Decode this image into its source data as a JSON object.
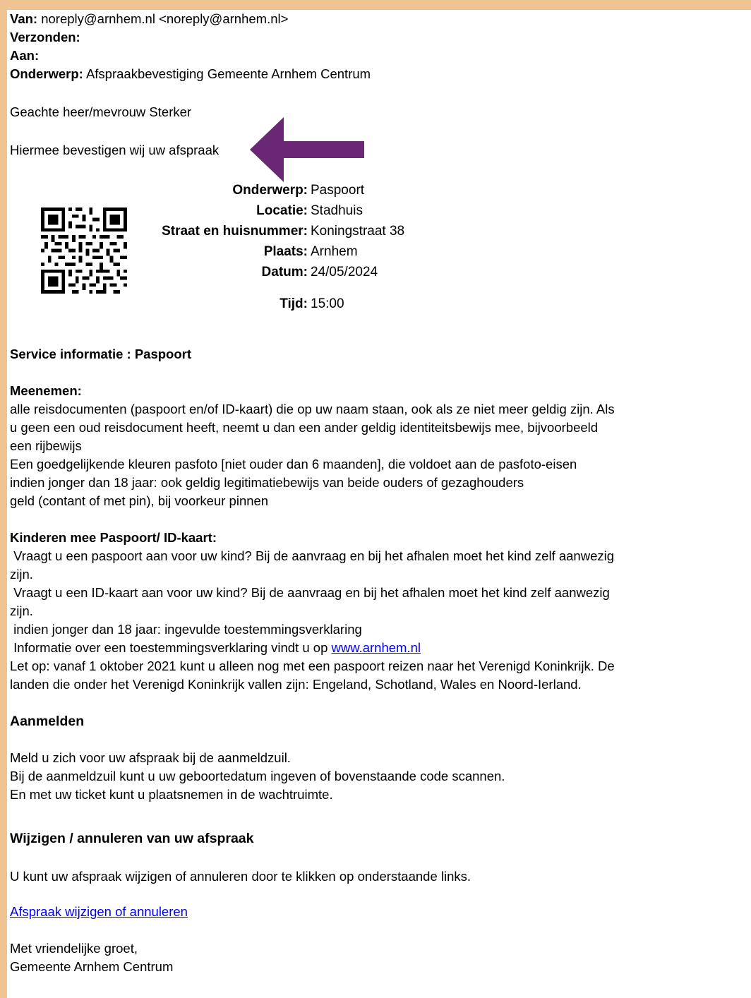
{
  "header": {
    "from_label": "Van:",
    "from_value": "noreply@arnhem.nl <noreply@arnhem.nl>",
    "sent_label": "Verzonden:",
    "to_label": "Aan:",
    "subject_label": "Onderwerp:",
    "subject_value": "Afspraakbevestiging Gemeente Arnhem Centrum"
  },
  "greeting": "Geachte heer/mevrouw Sterker",
  "confirm_text": "Hiermee bevestigen wij uw afspraak",
  "arrow_color": "#6a2776",
  "appointment": {
    "subject_label": "Onderwerp:",
    "subject_value": "Paspoort",
    "location_label": "Locatie:",
    "location_value": "Stadhuis",
    "street_label": "Straat en huisnummer:",
    "street_value": "Koningstraat 38",
    "city_label": "Plaats:",
    "city_value": "Arnhem",
    "date_label": "Datum:",
    "date_value": "24/05/2024",
    "time_label": "Tijd:",
    "time_value": "15:00"
  },
  "service_heading": "Service informatie : Paspoort",
  "bring": {
    "heading": "Meenemen:",
    "lines": [
      "alle reisdocumenten (paspoort en/of ID-kaart) die op uw naam staan, ook als ze niet meer geldig zijn. Als",
      "u  geen een oud reisdocument heeft, neemt u dan een ander geldig identiteitsbewijs mee, bijvoorbeeld",
      "een rijbewijs",
      "Een goedgelijkende kleuren pasfoto [niet ouder dan 6 maanden], die voldoet aan de pasfoto-eisen",
      "indien jonger dan 18 jaar: ook geldig legitimatiebewijs van beide ouders of gezaghouders",
      "geld (contant of met pin), bij voorkeur pinnen"
    ]
  },
  "children": {
    "heading": "Kinderen mee Paspoort/ ID-kaart:",
    "lines": [
      " Vraagt u een paspoort aan voor uw kind? Bij de aanvraag en bij het afhalen moet het kind zelf aanwezig",
      "zijn.",
      " Vraagt u een ID-kaart aan voor uw kind? Bij de aanvraag en bij het afhalen moet het kind zelf aanwezig",
      "zijn.",
      " indien jonger dan 18 jaar: ingevulde toestemmingsverklaring"
    ],
    "info_text": " Informatie over een toestemmingsverklaring vindt u op ",
    "info_link": "www.arnhem.nl",
    "note_lines": [
      "Let op: vanaf 1 oktober 2021  kunt u alleen nog met een paspoort reizen naar het Verenigd Koninkrijk. De",
      "landen die onder het Verenigd Koninkrijk vallen zijn: Engeland, Schotland, Wales en Noord-Ierland."
    ]
  },
  "register": {
    "heading": "Aanmelden",
    "lines": [
      "Meld u zich voor uw afspraak bij de aanmeldzuil.",
      "Bij de aanmeldzuil kunt u uw geboortedatum ingeven of bovenstaande code scannen.",
      "En met uw ticket kunt u plaatsnemen in de wachtruimte."
    ]
  },
  "change": {
    "heading": "Wijzigen / annuleren van uw afspraak",
    "text": "U kunt uw afspraak wijzigen of annuleren door te klikken op onderstaande links.",
    "link": "Afspraak wijzigen of annuleren"
  },
  "closing": {
    "line1": "Met vriendelijke groet,",
    "line2": "Gemeente Arnhem Centrum"
  },
  "colors": {
    "frame": "#f0c492",
    "link": "#0000ee"
  }
}
